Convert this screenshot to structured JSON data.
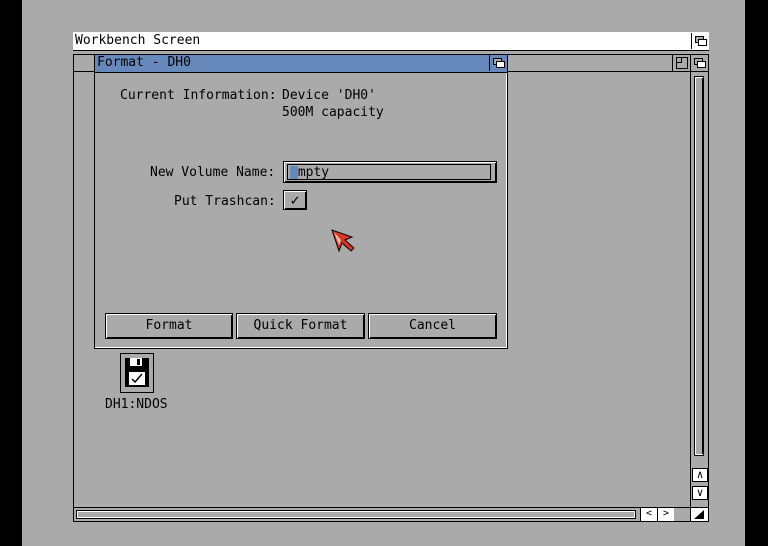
{
  "screen": {
    "title": "Workbench Screen"
  },
  "workbench_window": {
    "icons": [
      {
        "label": "DH1:NDOS",
        "icon": "floppy-disk-icon"
      }
    ],
    "scroll_up": "∧",
    "scroll_down": "∨",
    "scroll_left": "<",
    "scroll_right": ">"
  },
  "format_dialog": {
    "title": "Format - DH0",
    "current_info_label": "Current Information:",
    "device_line": "Device 'DH0'",
    "capacity_line": "500M capacity",
    "volume_name_label": "New Volume Name:",
    "volume_name_value": "Empty",
    "trashcan_label": "Put Trashcan:",
    "trashcan_checked": "✓",
    "buttons": {
      "format": "Format",
      "quick_format": "Quick Format",
      "cancel": "Cancel"
    }
  },
  "colors": {
    "screen_bg": "#aaaaaa",
    "active_title": "#6688bb",
    "pointer": "#dd3322"
  }
}
